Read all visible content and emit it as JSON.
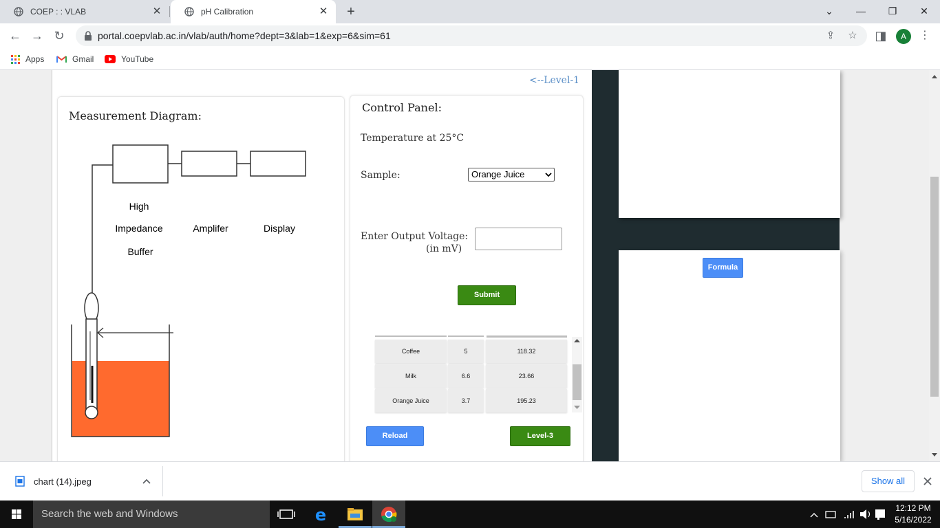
{
  "browser": {
    "tabs": [
      {
        "title": "COEP : : VLAB"
      },
      {
        "title": "pH Calibration"
      }
    ],
    "url": "portal.coepvlab.ac.in/vlab/auth/home?dept=3&lab=1&exp=6&sim=61",
    "profile_initial": "A",
    "bookmarks": [
      {
        "label": "Apps"
      },
      {
        "label": "Gmail"
      },
      {
        "label": "YouTube"
      }
    ]
  },
  "page": {
    "back_link": "<--Level-1",
    "diagram": {
      "title": "Measurement Diagram:",
      "labels": {
        "buffer_line1": "High",
        "buffer_line2": "Impedance",
        "buffer_line3": "Buffer",
        "amplifier": "Amplifer",
        "display": "Display"
      },
      "solution_color": "#ff6a2e"
    },
    "control_panel": {
      "title": "Control Panel:",
      "temperature": "Temperature at 25°C",
      "sample_label": "Sample:",
      "sample_selected": "Orange Juice",
      "voltage_label": "Enter Output Voltage:",
      "voltage_unit": "(in mV)",
      "voltage_value": "",
      "submit_label": "Submit",
      "reload_label": "Reload",
      "next_label": "Level-3"
    },
    "results": [
      {
        "sample": "Coffee",
        "ph": "5",
        "mv": "118.32"
      },
      {
        "sample": "Milk",
        "ph": "6.6",
        "mv": "23.66"
      },
      {
        "sample": "Orange Juice",
        "ph": "3.7",
        "mv": "195.23"
      }
    ],
    "formula_label": "Formula"
  },
  "downloads": {
    "file": "chart (14).jpeg",
    "show_all": "Show all"
  },
  "taskbar": {
    "search_placeholder": "Search the web and Windows",
    "time": "12:12 PM",
    "date": "5/16/2022"
  },
  "colors": {
    "green_button": "#3a8a13",
    "blue_button": "#4c8ef7",
    "dark_panel": "#1f2c30"
  }
}
